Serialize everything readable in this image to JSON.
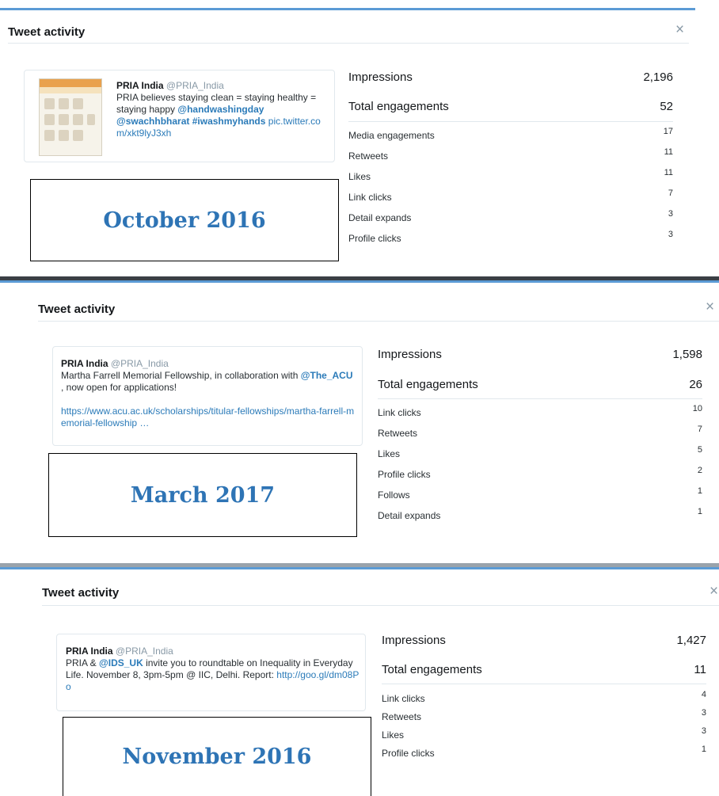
{
  "panels": [
    {
      "title": "Tweet activity",
      "close_glyph": "×",
      "tweet": {
        "author": "PRIA India",
        "handle": "@PRIA_India",
        "segments": [
          {
            "text": "PRIA believes staying clean = staying healthy = staying happy ",
            "kind": "plain"
          },
          {
            "text": "@handwashingday",
            "kind": "mention"
          },
          {
            "text": " ",
            "kind": "plain"
          },
          {
            "text": "@swachhbharat",
            "kind": "mention"
          },
          {
            "text": " ",
            "kind": "plain"
          },
          {
            "text": "#iwashmyhands",
            "kind": "mention"
          },
          {
            "text": " ",
            "kind": "plain"
          },
          {
            "text": "pic.twitter.com/xkt9lyJ3xh",
            "kind": "link"
          }
        ],
        "has_image": true
      },
      "month": "October 2016",
      "impressions": {
        "label": "Impressions",
        "value": "2,196"
      },
      "engagements": {
        "label": "Total engagements",
        "value": "52"
      },
      "breakdown": [
        {
          "label": "Media engagements",
          "value": "17"
        },
        {
          "label": "Retweets",
          "value": "11"
        },
        {
          "label": "Likes",
          "value": "11"
        },
        {
          "label": "Link clicks",
          "value": "7"
        },
        {
          "label": "Detail expands",
          "value": "3"
        },
        {
          "label": "Profile clicks",
          "value": "3"
        }
      ]
    },
    {
      "title": "Tweet activity",
      "close_glyph": "×",
      "tweet": {
        "author": "PRIA India",
        "handle": "@PRIA_India",
        "segments": [
          {
            "text": "Martha Farrell Memorial Fellowship, in collaboration with ",
            "kind": "plain"
          },
          {
            "text": "@The_ACU",
            "kind": "mention"
          },
          {
            "text": " , now open for applications!",
            "kind": "plain"
          },
          {
            "text": "\n\n",
            "kind": "break"
          },
          {
            "text": "https://www.acu.ac.uk/scholarships/titular-fellowships/martha-farrell-memorial-fellowship …",
            "kind": "link"
          }
        ],
        "has_image": false
      },
      "month": "March 2017",
      "impressions": {
        "label": "Impressions",
        "value": "1,598"
      },
      "engagements": {
        "label": "Total engagements",
        "value": "26"
      },
      "breakdown": [
        {
          "label": "Link clicks",
          "value": "10"
        },
        {
          "label": "Retweets",
          "value": "7"
        },
        {
          "label": "Likes",
          "value": "5"
        },
        {
          "label": "Profile clicks",
          "value": "2"
        },
        {
          "label": "Follows",
          "value": "1"
        },
        {
          "label": "Detail expands",
          "value": "1"
        }
      ]
    },
    {
      "title": "Tweet activity",
      "close_glyph": "×",
      "tweet": {
        "author": "PRIA India",
        "handle": "@PRIA_India",
        "segments": [
          {
            "text": "PRIA & ",
            "kind": "plain"
          },
          {
            "text": "@IDS_UK",
            "kind": "mention"
          },
          {
            "text": " invite you to roundtable on Inequality in Everyday Life. November 8, 3pm-5pm @ IIC, Delhi. Report: ",
            "kind": "plain"
          },
          {
            "text": "http://goo.gl/dm08Po",
            "kind": "link"
          }
        ],
        "has_image": false
      },
      "month": "November 2016",
      "impressions": {
        "label": "Impressions",
        "value": "1,427"
      },
      "engagements": {
        "label": "Total engagements",
        "value": "11"
      },
      "breakdown": [
        {
          "label": "Link clicks",
          "value": "4"
        },
        {
          "label": "Retweets",
          "value": "3"
        },
        {
          "label": "Likes",
          "value": "3"
        },
        {
          "label": "Profile clicks",
          "value": "1"
        }
      ]
    }
  ],
  "colors": {
    "accent_link": "#2b7bb9",
    "month_label": "#2e74b5",
    "top_rule": "#5b9bd5",
    "muted": "#8899a6"
  }
}
